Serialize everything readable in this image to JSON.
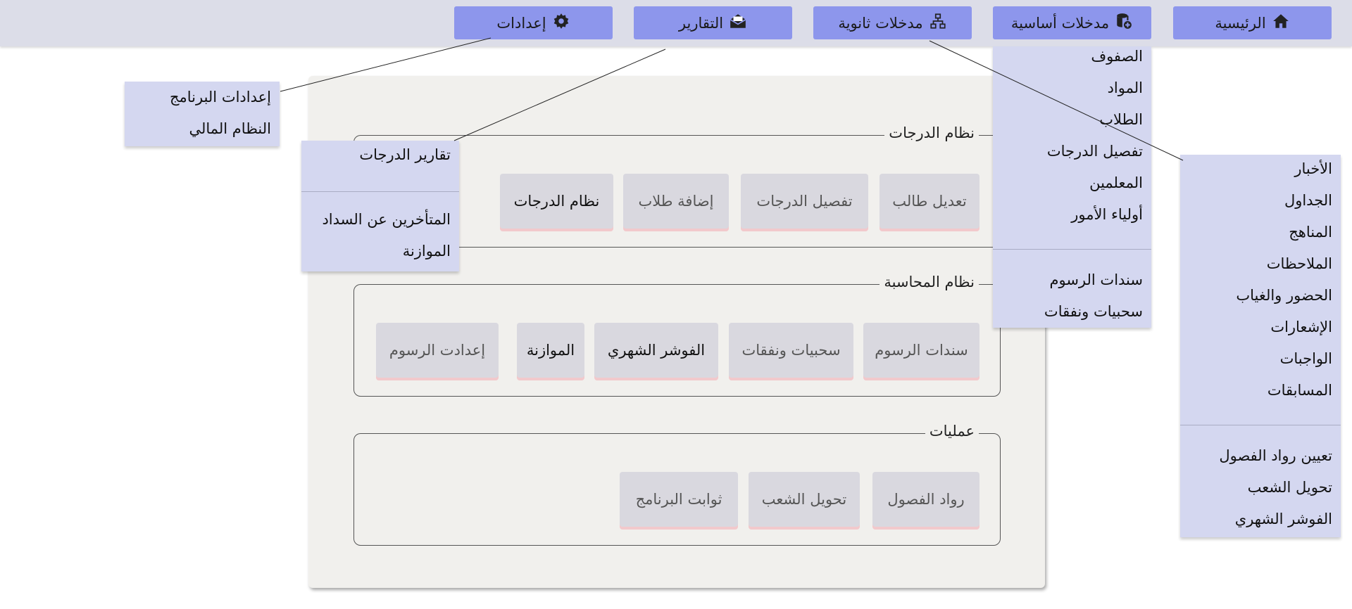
{
  "nav": {
    "home": "الرئيسية",
    "basic_inputs": "مدخلات أساسية",
    "secondary_inputs": "مدخلات ثانوية",
    "reports": "التقارير",
    "settings": "إعدادات"
  },
  "basic_menu": {
    "items": [
      "الصفوف",
      "المواد",
      "الطلاب",
      "تفصيل الدرجات",
      "المعلمين",
      "أولياء الأمور"
    ],
    "items_after_sep": [
      "سندات الرسوم",
      "سحبيات ونفقات"
    ]
  },
  "secondary_menu": {
    "items": [
      "الأخبار",
      "الجداول",
      "المناهج",
      "الملاحظات",
      "الحضور والغياب",
      "الإشعارات",
      "الواجبات",
      "المسابقات"
    ],
    "items_after_sep": [
      "تعيين رواد الفصول",
      "تحويل الشعب",
      "الفوشر الشهري"
    ]
  },
  "reports_menu": {
    "items": [
      "تقارير الدرجات"
    ],
    "items_after_sep": [
      "المتأخرين عن السداد",
      "الموازنة"
    ]
  },
  "settings_menu": {
    "items": [
      "إعدادات البرنامج",
      "النظام المالي"
    ]
  },
  "groups": {
    "grades": {
      "title": "نظام الدرجات",
      "tiles": [
        "تعديل طالب",
        "تفصيل الدرجات",
        "إضافة طلاب",
        "نظام الدرجات"
      ]
    },
    "accounting": {
      "title": "نظام المحاسبة",
      "tiles": [
        "سندات الرسوم",
        "سحبيات ونفقات",
        "الفوشر الشهري",
        "الموازنة",
        "إعدادت الرسوم"
      ]
    },
    "operations": {
      "title": "عمليات",
      "tiles": [
        "رواد الفصول",
        "تحويل الشعب",
        "ثوابت البرنامج"
      ]
    }
  },
  "colors": {
    "topbar": "#dcdde8",
    "nav_button": "#8d96ec",
    "menu": "#d4d7f0",
    "panel": "#f1f0ed",
    "tile": "#d9d8df"
  }
}
